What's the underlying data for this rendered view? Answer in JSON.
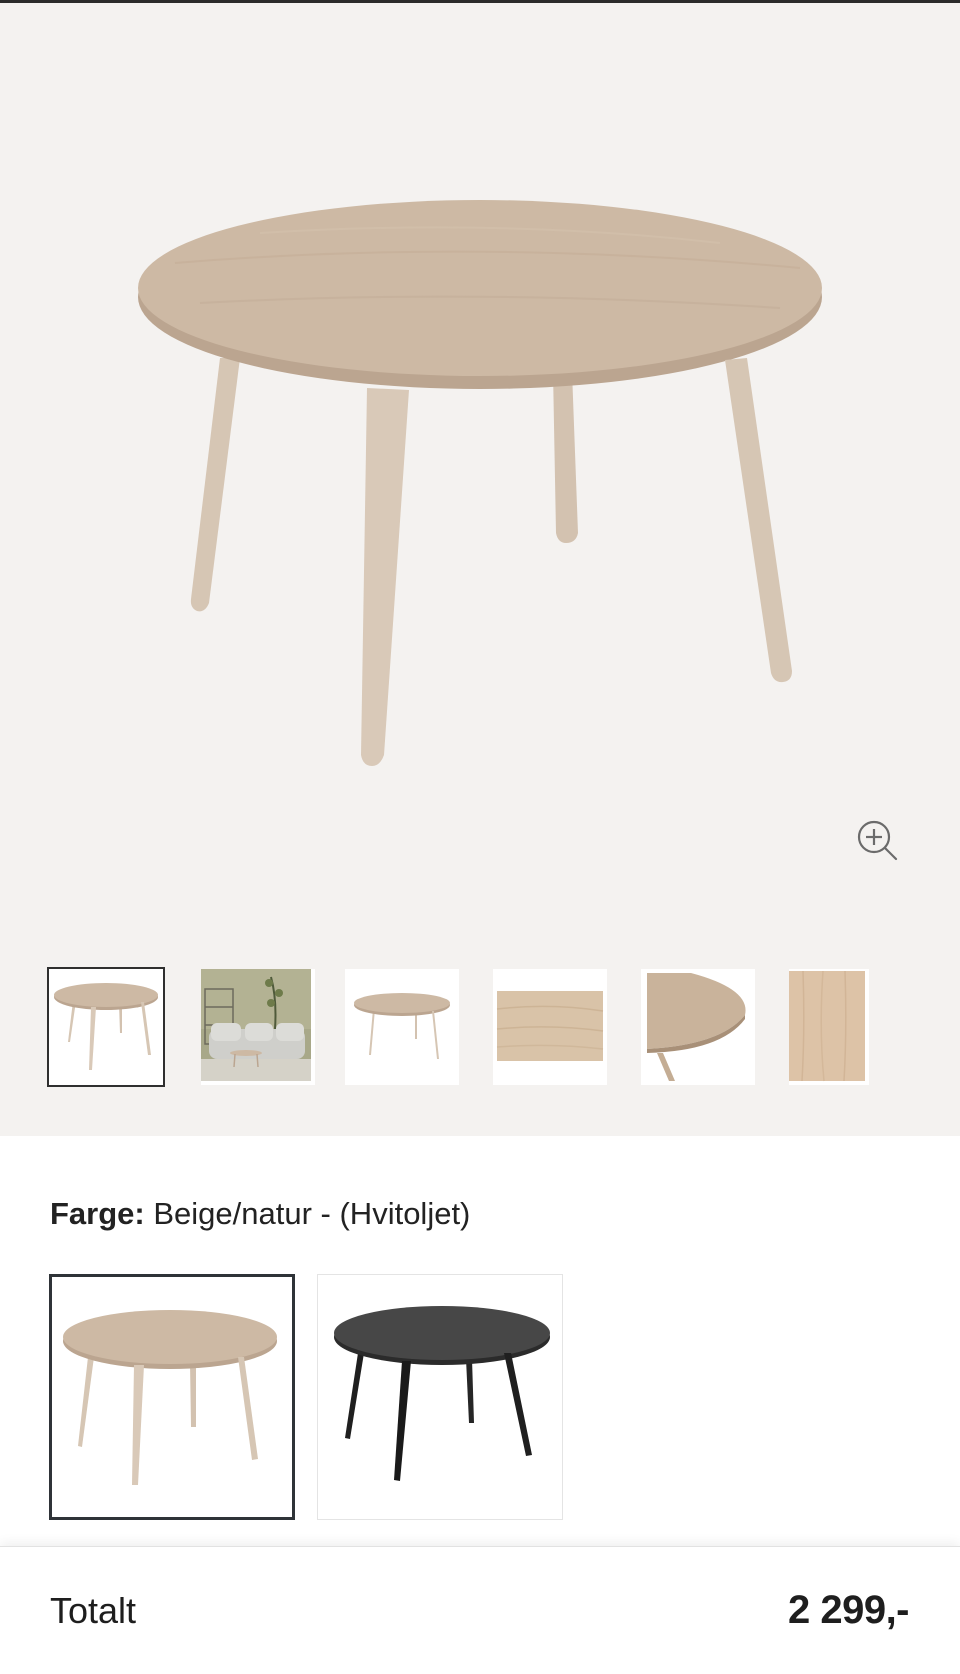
{
  "product": {
    "name": "",
    "image_alt": ""
  },
  "gallery": {
    "zoom_icon": "zoom-in-icon",
    "thumbnails": [
      {
        "kind": "product-front",
        "selected": true
      },
      {
        "kind": "room-scene",
        "selected": false
      },
      {
        "kind": "product-front-small",
        "selected": false
      },
      {
        "kind": "wood-texture",
        "selected": false
      },
      {
        "kind": "tabletop-edge",
        "selected": false
      },
      {
        "kind": "wood-grain",
        "selected": false
      }
    ]
  },
  "color": {
    "label": "Farge:",
    "value": "Beige/natur - (Hvitoljet)",
    "options": [
      {
        "name": "beige-natur",
        "color": "#cdb9a4",
        "selected": true
      },
      {
        "name": "black",
        "color": "#3f3f3f",
        "selected": false
      }
    ]
  },
  "footer": {
    "total_label": "Totalt",
    "total_price": "2 299,-"
  },
  "colors": {
    "wood": "#cdb9a4",
    "wood_dark": "#b8a38d",
    "wood_edge": "#bda893",
    "leg": "#d7c7b5",
    "background": "#f4f2f0",
    "selected_border": "#2f3338"
  }
}
